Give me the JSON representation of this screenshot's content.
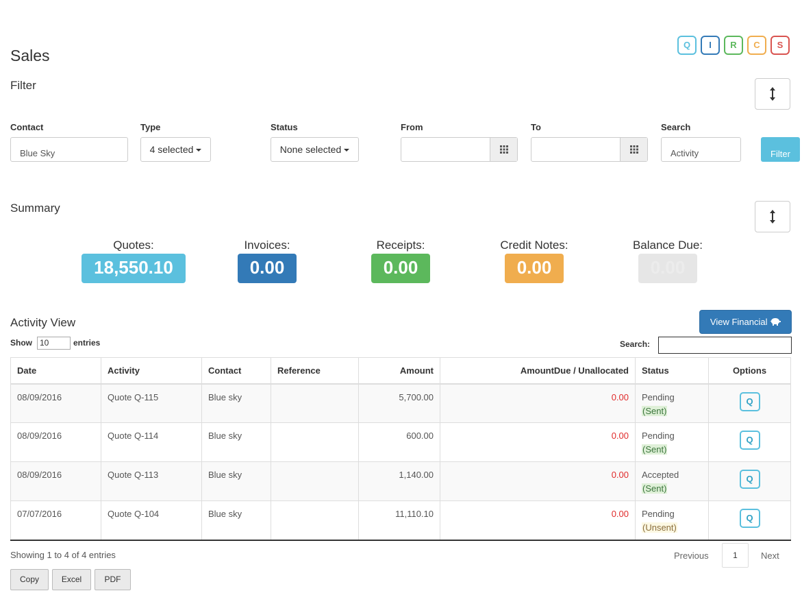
{
  "header": {
    "title": "Sales",
    "type_buttons": [
      {
        "letter": "Q",
        "color": "#5bc0de"
      },
      {
        "letter": "I",
        "color": "#337ab7"
      },
      {
        "letter": "R",
        "color": "#5cb85c"
      },
      {
        "letter": "C",
        "color": "#f0ad4e"
      },
      {
        "letter": "S",
        "color": "#d9534f"
      }
    ]
  },
  "filter": {
    "title": "Filter",
    "contact": {
      "label": "Contact",
      "value": "Blue Sky"
    },
    "type": {
      "label": "Type",
      "value": "4 selected"
    },
    "status": {
      "label": "Status",
      "value": "None selected"
    },
    "from": {
      "label": "From",
      "value": ""
    },
    "to": {
      "label": "To",
      "value": ""
    },
    "search": {
      "label": "Search",
      "value": "Activity"
    },
    "button": "Filter"
  },
  "summary": {
    "title": "Summary",
    "items": [
      {
        "label": "Quotes:",
        "value": "18,550.10",
        "color": "#5bc0de"
      },
      {
        "label": "Invoices:",
        "value": "0.00",
        "color": "#337ab7"
      },
      {
        "label": "Receipts:",
        "value": "0.00",
        "color": "#5cb85c"
      },
      {
        "label": "Credit Notes:",
        "value": "0.00",
        "color": "#f0ad4e"
      },
      {
        "label": "Balance Due:",
        "value": "0.00",
        "color": "#e6e6e6"
      }
    ]
  },
  "activity": {
    "title": "Activity View",
    "view_financial": "View Financial",
    "show_label": "Show",
    "show_value": "10",
    "entries_label": "entries",
    "search_label": "Search:",
    "search_value": "",
    "columns": [
      "Date",
      "Activity",
      "Contact",
      "Reference",
      "Amount",
      "AmountDue / Unallocated",
      "Status",
      "Options"
    ],
    "rows": [
      {
        "date": "08/09/2016",
        "activity": "Quote Q-115",
        "contact": "Blue sky",
        "reference": "",
        "amount": "5,700.00",
        "due": "0.00",
        "status": "Pending",
        "sub": "(Sent)",
        "sub_kind": "sent",
        "option": "Q"
      },
      {
        "date": "08/09/2016",
        "activity": "Quote Q-114",
        "contact": "Blue sky",
        "reference": "",
        "amount": "600.00",
        "due": "0.00",
        "status": "Pending",
        "sub": "(Sent)",
        "sub_kind": "sent",
        "option": "Q"
      },
      {
        "date": "08/09/2016",
        "activity": "Quote Q-113",
        "contact": "Blue sky",
        "reference": "",
        "amount": "1,140.00",
        "due": "0.00",
        "status": "Accepted",
        "sub": "(Sent)",
        "sub_kind": "sent",
        "option": "Q"
      },
      {
        "date": "07/07/2016",
        "activity": "Quote Q-104",
        "contact": "Blue sky",
        "reference": "",
        "amount": "11,110.10",
        "due": "0.00",
        "status": "Pending",
        "sub": "(Unsent)",
        "sub_kind": "unsent",
        "option": "Q"
      }
    ],
    "info": "Showing 1 to 4 of 4 entries",
    "pagination": {
      "previous": "Previous",
      "current": "1",
      "next": "Next"
    },
    "export": [
      "Copy",
      "Excel",
      "PDF"
    ]
  }
}
